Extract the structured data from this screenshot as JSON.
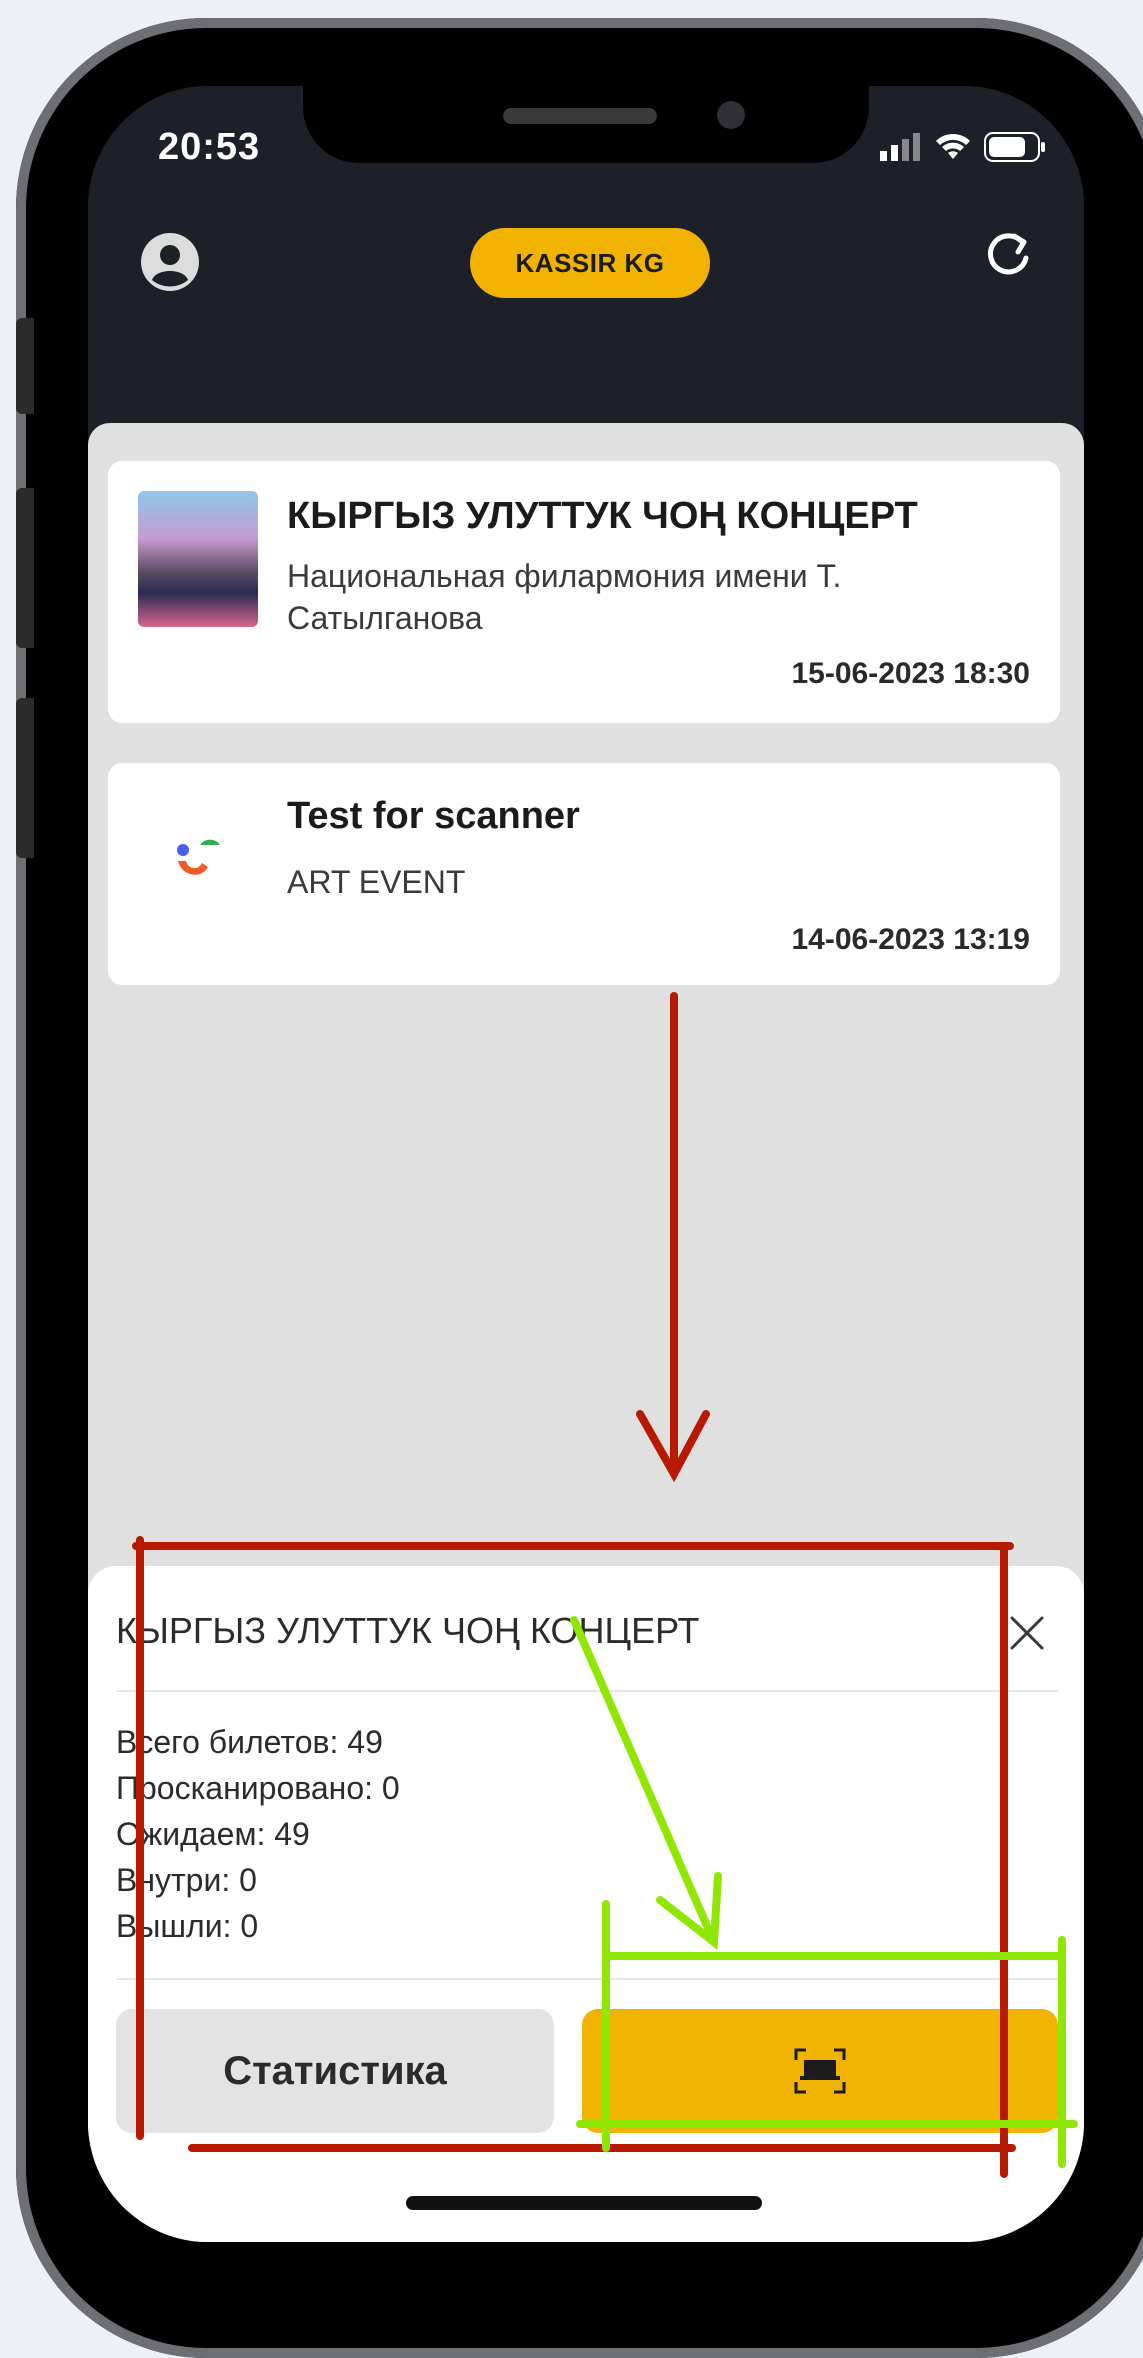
{
  "status_bar": {
    "time": "20:53"
  },
  "header": {
    "brand": "KASSIR KG"
  },
  "events": [
    {
      "title": "КЫРГЫЗ УЛУТТУК  ЧОҢ КОНЦЕРТ",
      "venue": "Национальная филармония имени Т. Сатылганова",
      "datetime": "15-06-2023 18:30"
    },
    {
      "title": "Test for scanner",
      "venue": "ART EVENT",
      "datetime": "14-06-2023 13:19"
    }
  ],
  "sheet": {
    "title": "КЫРГЫЗ УЛУТТУК  ЧОҢ КОНЦЕРТ",
    "stats": [
      "Всего билетов: 49",
      "Просканировано: 0",
      "Ожидаем: 49",
      "Внутри: 0",
      "Вышли: 0"
    ],
    "stats_button": "Статистика",
    "scan_icon": "scan-icon"
  },
  "colors": {
    "accent": "#f0b400",
    "annotation_red": "#b81a00",
    "annotation_green": "#8fe600"
  }
}
